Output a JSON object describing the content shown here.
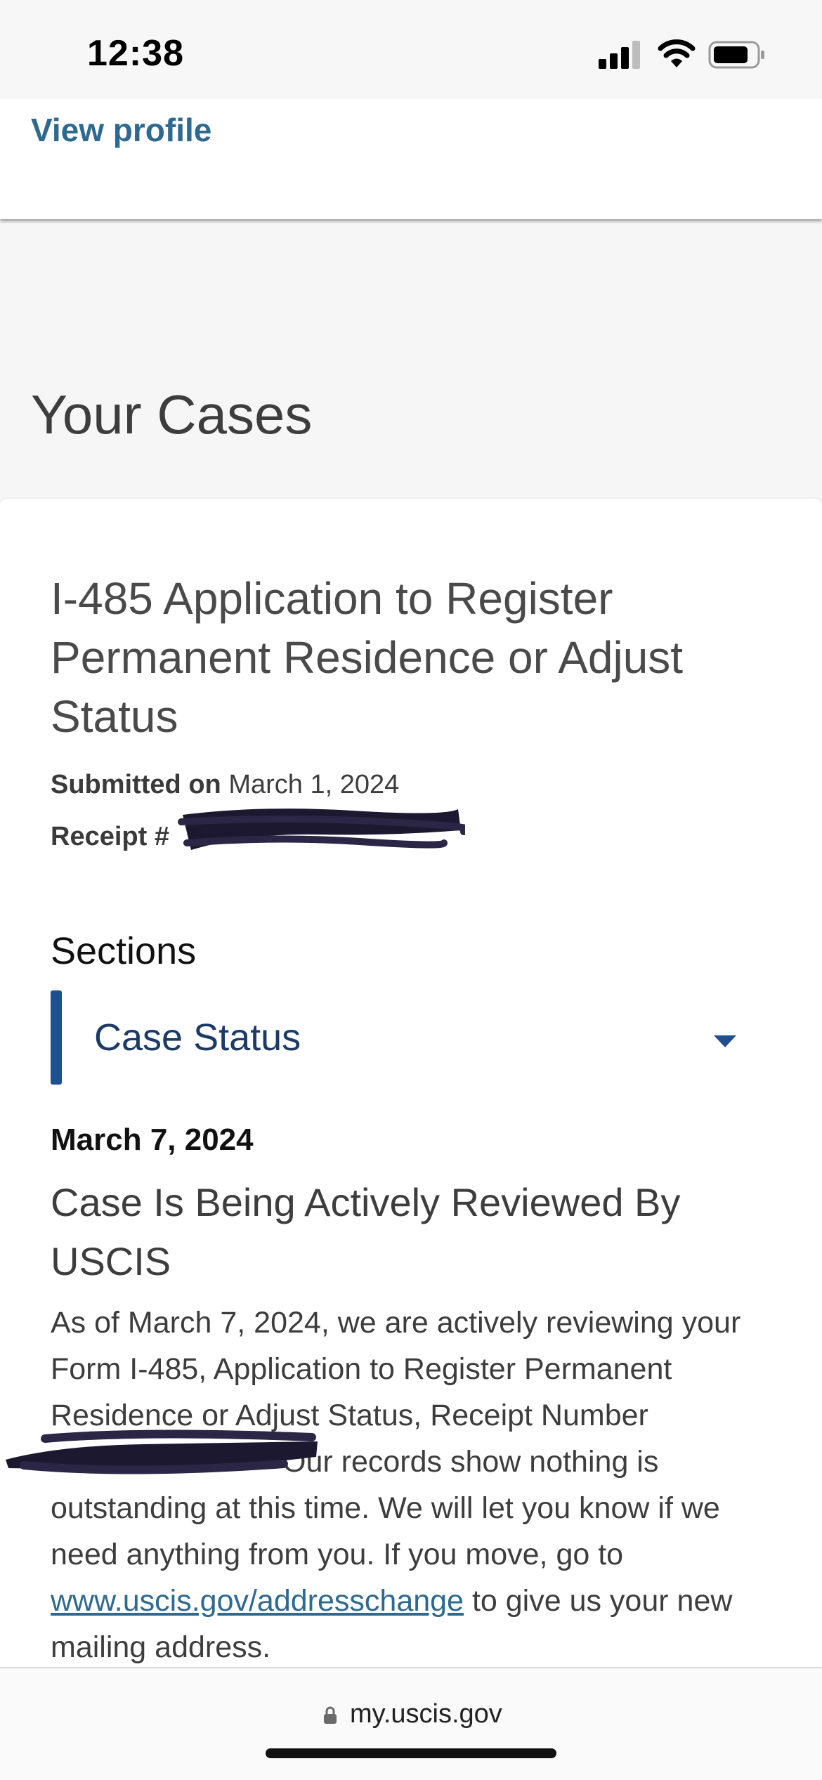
{
  "status_bar": {
    "time": "12:38",
    "icons": [
      "signal-icon",
      "wifi-icon",
      "battery-icon"
    ]
  },
  "profile": {
    "view_profile_label": "View profile"
  },
  "page": {
    "title": "Your Cases"
  },
  "case": {
    "title": "I-485 Application to Register Permanent Residence or Adjust Status",
    "submitted_label": "Submitted on",
    "submitted_date": "March 1, 2024",
    "receipt_label": "Receipt #"
  },
  "sections": {
    "label": "Sections",
    "selected": "Case Status"
  },
  "case_status": {
    "date": "March 7, 2024",
    "heading": "Case Is Being Actively Reviewed By USCIS",
    "body_part1": "As of March 7, 2024, we are actively reviewing your Form I-485, Application to Register Permanent Residence or Adjust Status, Receipt Number",
    "body_part2": "Our records show nothing is outstanding at this time. We will let you know if we need anything from you. If you move, go to",
    "link_text": "www.uscis.gov/addresschange",
    "body_part3": "to give us your new mailing address."
  },
  "browser": {
    "url": "my.uscis.gov"
  },
  "colors": {
    "link": "#2e6990",
    "accent": "#1e4f8f",
    "redaction": "#1c1830"
  }
}
